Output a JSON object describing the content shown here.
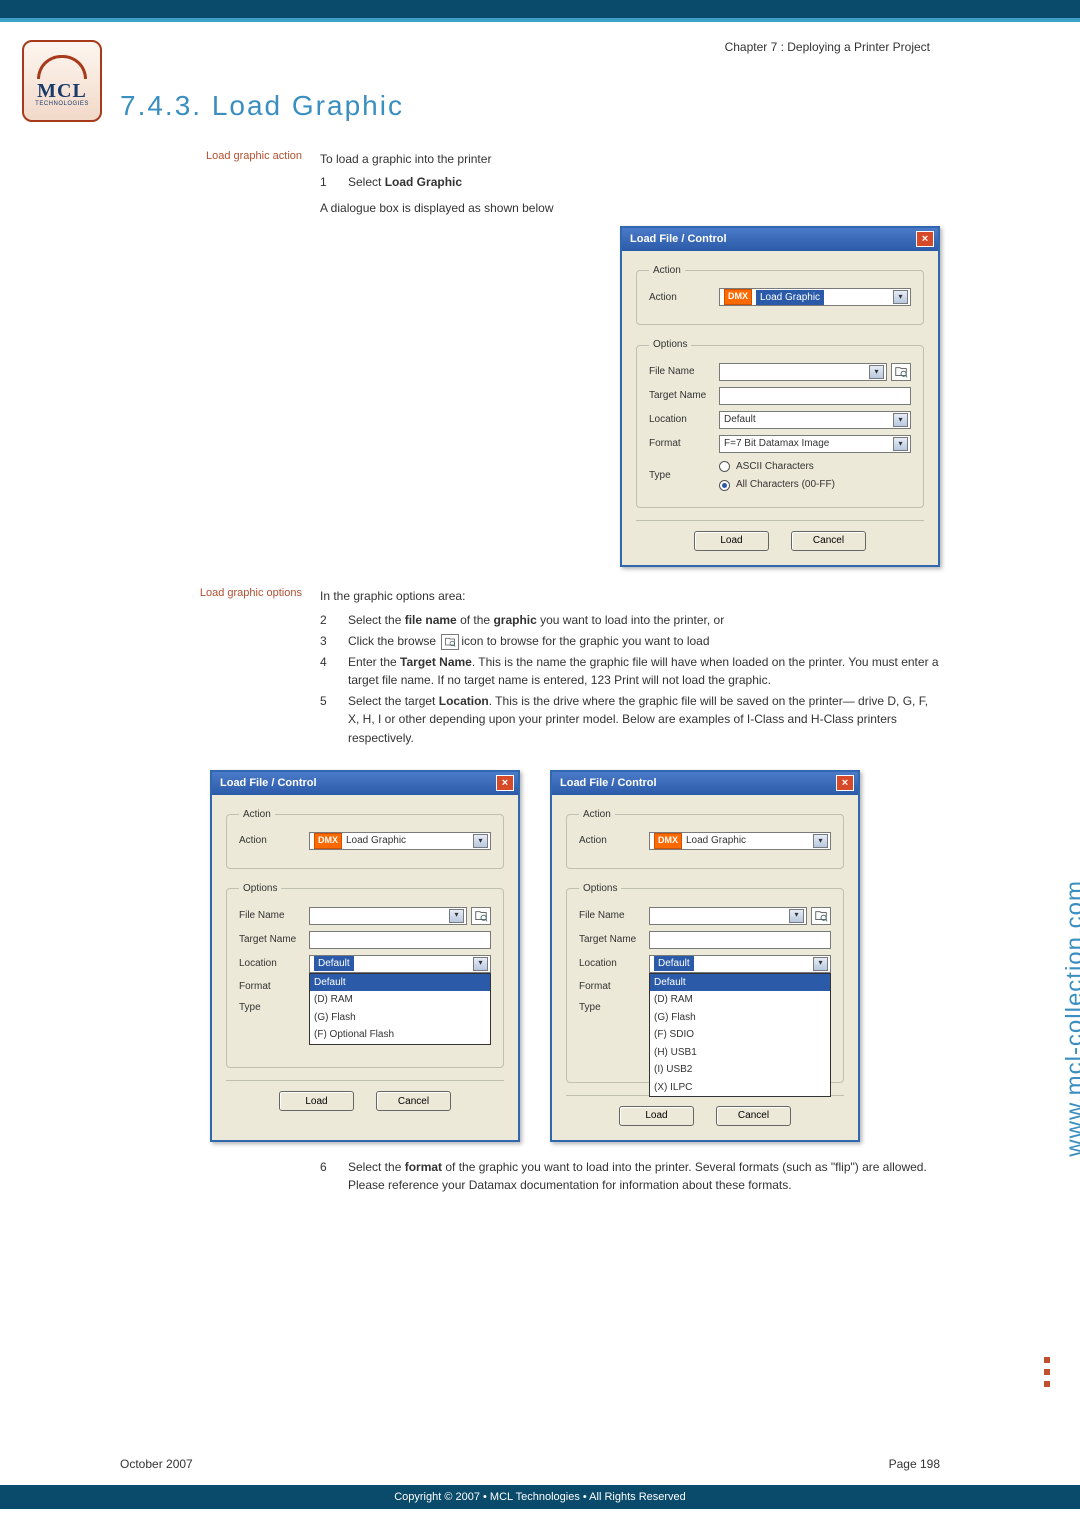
{
  "breadcrumb": "Chapter 7 : Deploying a Printer Project",
  "title": "7.4.3.   Load Graphic",
  "section1": {
    "label": "Load graphic action",
    "intro": "To load a graphic into the printer",
    "step1_num": "1",
    "step1_txt_a": "Select ",
    "step1_txt_b": "Load Graphic",
    "line2": "A dialogue box is displayed as shown below"
  },
  "dialog_main": {
    "title": "Load File / Control",
    "groups": {
      "action": "Action",
      "options": "Options"
    },
    "labels": {
      "action": "Action",
      "file_name": "File Name",
      "target_name": "Target Name",
      "location": "Location",
      "format": "Format",
      "type": "Type"
    },
    "values": {
      "action_badge": "DMX",
      "action_text": "Load Graphic",
      "location": "Default",
      "format": "F=7 Bit Datamax Image"
    },
    "radios": {
      "r1": "ASCII Characters",
      "r2": "All Characters (00-FF)"
    },
    "buttons": {
      "load": "Load",
      "cancel": "Cancel"
    }
  },
  "section2": {
    "label": "Load graphic options",
    "intro": "In the graphic options area:",
    "steps": [
      {
        "num": "2",
        "txt_a": "Select the ",
        "b1": "file name",
        "txt_b": " of the ",
        "b2": "graphic",
        "txt_c": " you want to load into the printer, or"
      },
      {
        "num": "3",
        "txt_a": "Click the browse ",
        "txt_b": "icon to browse for the graphic you want to load"
      },
      {
        "num": "4",
        "txt_a": "Enter the ",
        "b1": "Target Name",
        "txt_b": ". This is the name the graphic file will have when loaded on the printer. You must enter a target file name. If no target name is entered, 123 Print will not load the graphic."
      },
      {
        "num": "5",
        "txt_a": "Select the target ",
        "b1": "Location",
        "txt_b": ". This is the drive where the graphic file will be saved on the printer— drive D, G, F, X, H, I or other depending upon your printer model. Below are examples of I-Class and H-Class printers respectively."
      }
    ],
    "step6": {
      "num": "6",
      "txt_a": "Select the ",
      "b1": "format",
      "txt_b": " of the graphic you want to load into the printer. Several formats (such as \"flip\") are allowed. Please reference your Datamax documentation for information about these formats."
    }
  },
  "dialog_left": {
    "location_options": [
      "Default",
      "(D) RAM",
      "(G) Flash",
      "(F) Optional Flash"
    ],
    "overlap_text": "All Characters (00-FF)"
  },
  "dialog_right": {
    "location_options": [
      "Default",
      "(D) RAM",
      "(G) Flash",
      "(F) SDIO",
      "(H) USB1",
      "(I) USB2",
      "(X) ILPC"
    ]
  },
  "side_url": "www.mcl-collection.com",
  "footer": {
    "left": "October 2007",
    "right": "Page  198"
  },
  "copyright": "Copyright © 2007 • MCL Technologies • All Rights Reserved",
  "logo": {
    "main": "MCL",
    "sub": "TECHNOLOGIES"
  }
}
